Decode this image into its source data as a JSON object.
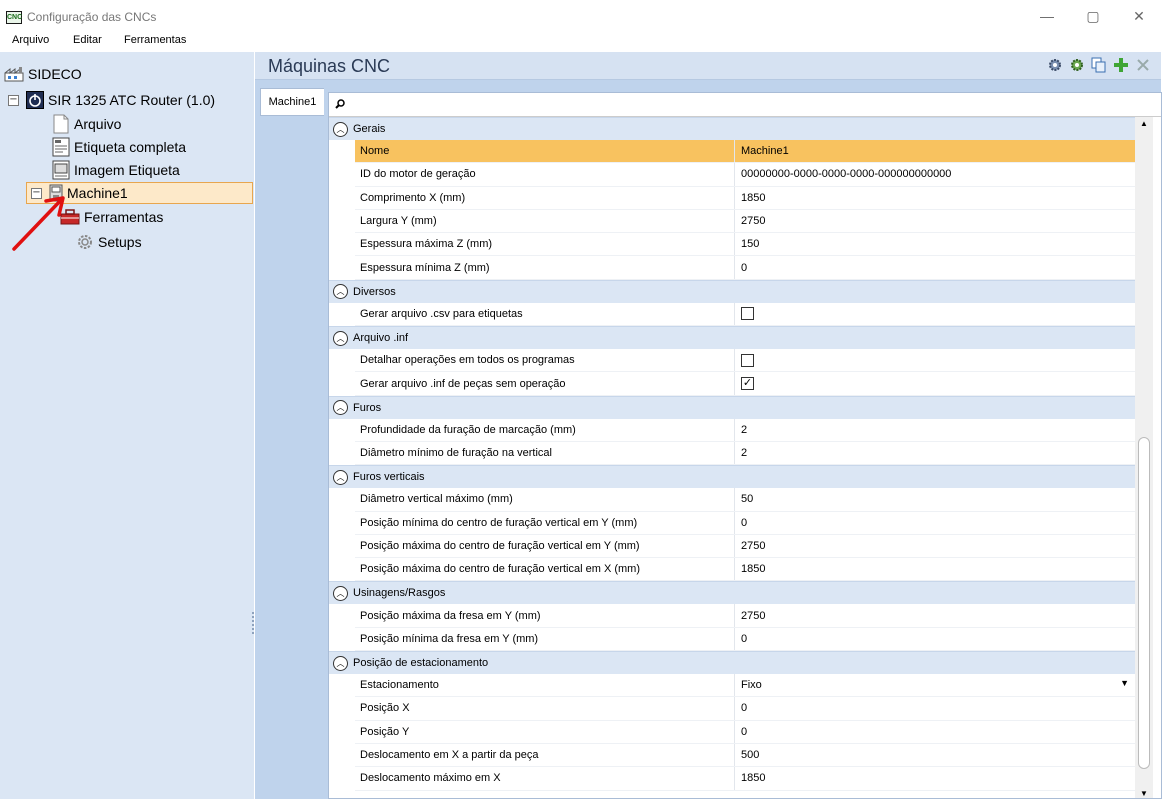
{
  "window": {
    "title": "Configuração das CNCs",
    "icon_label": "CNC",
    "minimize": "—",
    "maximize": "▢",
    "close": "✕"
  },
  "menu": [
    "Arquivo",
    "Editar",
    "Ferramentas"
  ],
  "tree": {
    "root": "SIDECO",
    "machine_node": "SIR 1325 ATC Router (1.0)",
    "children": [
      "Arquivo",
      "Etiqueta completa",
      "Imagem Etiqueta",
      "Machine1"
    ],
    "machine1_children": [
      "Ferramentas",
      "Setups"
    ]
  },
  "main": {
    "title": "Máquinas CNC",
    "tab": "Machine1"
  },
  "grid": [
    {
      "category": "Gerais",
      "rows": [
        {
          "name": "Nome",
          "value": "Machine1",
          "selected": true
        },
        {
          "name": "ID do motor de geração",
          "value": "00000000-0000-0000-0000-000000000000"
        },
        {
          "name": "Comprimento X (mm)",
          "value": "1850"
        },
        {
          "name": "Largura Y (mm)",
          "value": "2750"
        },
        {
          "name": "Espessura máxima Z (mm)",
          "value": "150"
        },
        {
          "name": "Espessura mínima Z (mm)",
          "value": "0"
        }
      ]
    },
    {
      "category": "Diversos",
      "rows": [
        {
          "name": "Gerar arquivo .csv para etiquetas",
          "value": "",
          "checkbox": false
        }
      ]
    },
    {
      "category": "Arquivo .inf",
      "rows": [
        {
          "name": "Detalhar operações em todos os programas",
          "value": "",
          "checkbox": false
        },
        {
          "name": "Gerar arquivo .inf de peças sem operação",
          "value": "",
          "checkbox": true
        }
      ]
    },
    {
      "category": "Furos",
      "rows": [
        {
          "name": "Profundidade da furação de marcação (mm)",
          "value": "2"
        },
        {
          "name": "Diâmetro mínimo de furação na vertical",
          "value": "2"
        }
      ]
    },
    {
      "category": "Furos verticais",
      "rows": [
        {
          "name": "Diâmetro vertical máximo (mm)",
          "value": "50"
        },
        {
          "name": "Posição mínima do centro de furação vertical em Y (mm)",
          "value": "0"
        },
        {
          "name": "Posição máxima do centro de furação vertical em Y (mm)",
          "value": "2750"
        },
        {
          "name": "Posição máxima do centro de furação vertical em X (mm)",
          "value": "1850"
        }
      ]
    },
    {
      "category": "Usinagens/Rasgos",
      "rows": [
        {
          "name": "Posição máxima da fresa em Y (mm)",
          "value": "2750"
        },
        {
          "name": "Posição mínima da fresa em Y (mm)",
          "value": "0"
        }
      ]
    },
    {
      "category": "Posição de estacionamento",
      "rows": [
        {
          "name": "Estacionamento",
          "value": "Fixo",
          "dropdown": true
        },
        {
          "name": "Posição X",
          "value": "0"
        },
        {
          "name": "Posição Y",
          "value": "0"
        },
        {
          "name": "Deslocamento em X a partir da peça",
          "value": "500"
        },
        {
          "name": "Deslocamento máximo em X",
          "value": "1850"
        }
      ]
    }
  ],
  "colors": {
    "accent_arrow": "#e01010",
    "selected_row": "#f8c25f",
    "tree_bg": "#dbe6f4"
  }
}
